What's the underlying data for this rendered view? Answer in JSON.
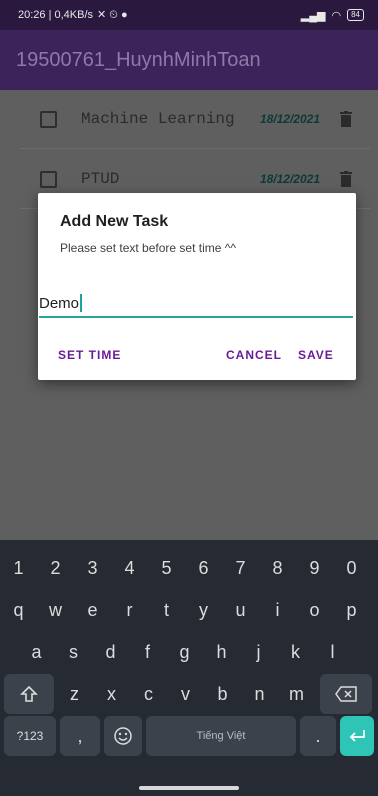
{
  "status_bar": {
    "time_info": "20:26 | 0,4KB/s",
    "battery": "84"
  },
  "app_bar": {
    "title": "19500761_HuynhMinhToan"
  },
  "tasks": [
    {
      "title": "Machine Learning",
      "date": "18/12/2021"
    },
    {
      "title": "PTUD",
      "date": "18/12/2021"
    }
  ],
  "dialog": {
    "title": "Add New Task",
    "message": "Please set text before set time ^^",
    "input_value": "Demo",
    "set_time_label": "SET TIME",
    "cancel_label": "CANCEL",
    "save_label": "SAVE"
  },
  "keyboard": {
    "row_numbers": [
      "1",
      "2",
      "3",
      "4",
      "5",
      "6",
      "7",
      "8",
      "9",
      "0"
    ],
    "row_top": [
      "q",
      "w",
      "e",
      "r",
      "t",
      "y",
      "u",
      "i",
      "o",
      "p"
    ],
    "row_mid": [
      "a",
      "s",
      "d",
      "f",
      "g",
      "h",
      "j",
      "k",
      "l"
    ],
    "row_bottom": [
      "z",
      "x",
      "c",
      "v",
      "b",
      "n",
      "m"
    ],
    "symbols_label": "?123",
    "comma_label": ",",
    "space_label": "Tiếng Việt",
    "period_label": "."
  },
  "colors": {
    "app_bar": "#3c2359",
    "accent": "#26a69a",
    "dialog_button": "#6a1b9a",
    "enter_key": "#2ec4b6"
  }
}
